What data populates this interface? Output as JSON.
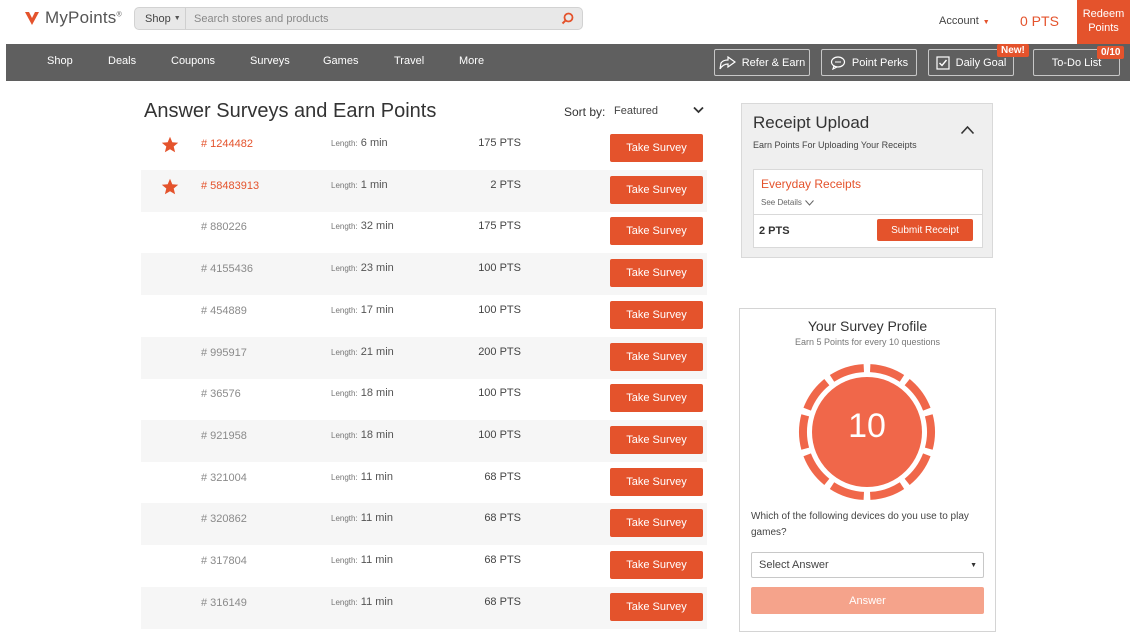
{
  "header": {
    "logo_text": "MyPoints",
    "logo_mark": "®",
    "shop_label": "Shop",
    "search_placeholder": "Search stores and products",
    "account_label": "Account",
    "points_balance": "0 PTS",
    "redeem_line1": "Redeem",
    "redeem_line2": "Points"
  },
  "nav": {
    "items": [
      "Shop",
      "Deals",
      "Coupons",
      "Surveys",
      "Games",
      "Travel",
      "More"
    ],
    "refer_label": "Refer & Earn",
    "perks_label": "Point Perks",
    "daily_goal_label": "Daily Goal",
    "new_badge": "New!",
    "todo_label": "To-Do List",
    "todo_count": "0/10"
  },
  "main": {
    "title": "Answer Surveys and Earn Points",
    "sort_label": "Sort by:",
    "sort_value": "Featured",
    "length_label": "Length:",
    "button_label": "Take Survey",
    "surveys": [
      {
        "id": "# 1244482",
        "length": "6 min",
        "points": "175 PTS",
        "featured": true
      },
      {
        "id": "# 58483913",
        "length": "1 min",
        "points": "2 PTS",
        "featured": true
      },
      {
        "id": "# 880226",
        "length": "32 min",
        "points": "175 PTS",
        "featured": false
      },
      {
        "id": "# 4155436",
        "length": "23 min",
        "points": "100 PTS",
        "featured": false
      },
      {
        "id": "# 454889",
        "length": "17 min",
        "points": "100 PTS",
        "featured": false
      },
      {
        "id": "# 995917",
        "length": "21 min",
        "points": "200 PTS",
        "featured": false
      },
      {
        "id": "# 36576",
        "length": "18 min",
        "points": "100 PTS",
        "featured": false
      },
      {
        "id": "# 921958",
        "length": "18 min",
        "points": "100 PTS",
        "featured": false
      },
      {
        "id": "# 321004",
        "length": "11 min",
        "points": "68 PTS",
        "featured": false
      },
      {
        "id": "# 320862",
        "length": "11 min",
        "points": "68 PTS",
        "featured": false
      },
      {
        "id": "# 317804",
        "length": "11 min",
        "points": "68 PTS",
        "featured": false
      },
      {
        "id": "# 316149",
        "length": "11 min",
        "points": "68 PTS",
        "featured": false
      }
    ]
  },
  "receipt": {
    "title": "Receipt Upload",
    "subtitle": "Earn Points For Uploading Your Receipts",
    "offer_name": "Everyday Receipts",
    "see_details": "See Details",
    "points": "2 PTS",
    "submit_label": "Submit Receipt"
  },
  "profile": {
    "title": "Your Survey Profile",
    "subtitle": "Earn 5 Points for every 10 questions",
    "progress_value": "10",
    "question": "Which of the following devices do you use to play games?",
    "select_placeholder": "Select Answer",
    "answer_label": "Answer"
  },
  "colors": {
    "accent": "#e4532c",
    "nav_bg": "#5f5f5f",
    "ring": "#f0674a",
    "answer_disabled": "#f5a38b"
  },
  "icons": {
    "logo": "mypoints-logo-mark",
    "search": "search-icon",
    "refer": "share-arrow-icon",
    "perks": "chat-bubble-icon",
    "daily_goal": "checkbox-icon",
    "featured": "star-icon",
    "collapse": "chevron-up-icon"
  }
}
